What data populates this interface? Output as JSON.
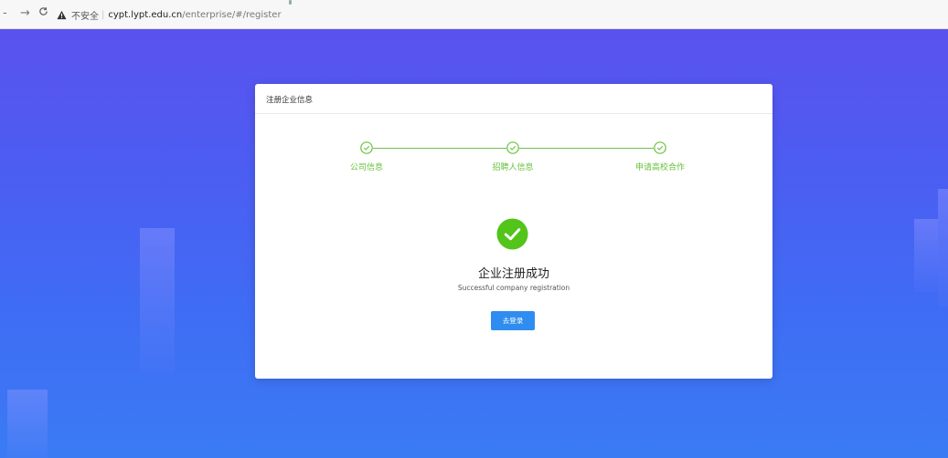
{
  "browser": {
    "back_icon": "back-arrow-icon",
    "forward_icon": "forward-arrow-icon",
    "reload_icon": "reload-icon",
    "warning_icon": "warning-triangle-icon",
    "insecure_label": "不安全",
    "separator": "|",
    "url_host": "cypt.lypt.edu.cn",
    "url_path": "/enterprise/#/register"
  },
  "card": {
    "title": "注册企业信息",
    "steps": [
      {
        "label": "公司信息",
        "status": "done"
      },
      {
        "label": "招聘人信息",
        "status": "done"
      },
      {
        "label": "申请高校合作",
        "status": "done"
      }
    ],
    "success_icon": "check-circle-icon",
    "success_title": "企业注册成功",
    "success_subtitle": "Successful company registration",
    "login_button": "去登录"
  },
  "colors": {
    "step_green": "#67c23a",
    "success_green": "#52c41a",
    "button_blue": "#2f8cf0",
    "background_top": "#5a52ee",
    "background_bottom": "#3a7bf4"
  }
}
